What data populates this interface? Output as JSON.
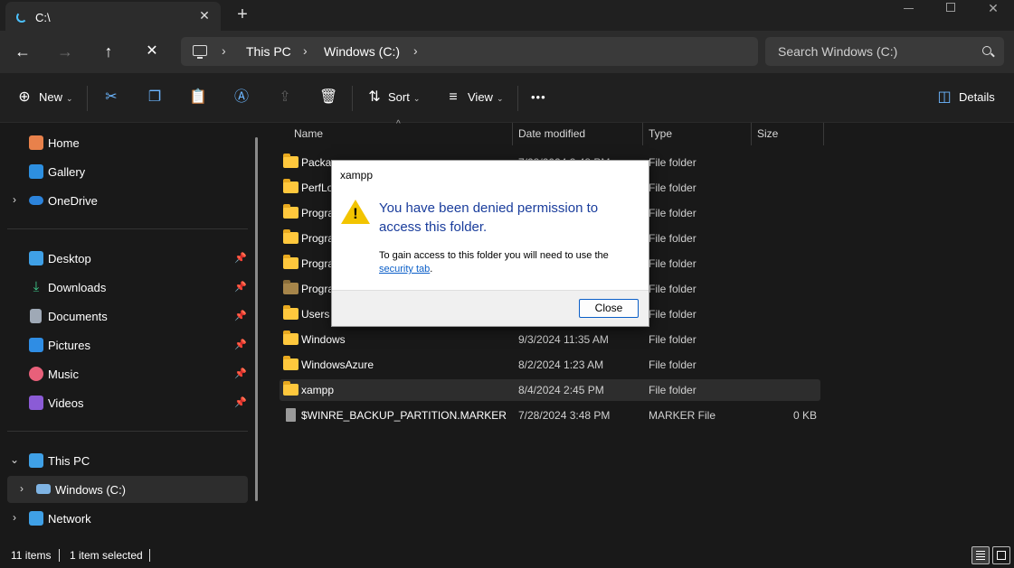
{
  "tab": {
    "title": "C:\\"
  },
  "window_controls": {
    "minimize": "minimize",
    "maximize": "maximize",
    "close": "close"
  },
  "address": {
    "crumbs": [
      "This PC",
      "Windows (C:)"
    ],
    "search_placeholder": "Search Windows (C:)"
  },
  "commands": {
    "new_label": "New",
    "sort_label": "Sort",
    "view_label": "View",
    "details_label": "Details",
    "more_label": "•••"
  },
  "sidebar": {
    "quick": [
      {
        "label": "Home",
        "icon": "home-icon"
      },
      {
        "label": "Gallery",
        "icon": "gallery-icon"
      },
      {
        "label": "OneDrive",
        "icon": "cloud-icon"
      }
    ],
    "pinned": [
      {
        "label": "Desktop",
        "icon": "desktop-icon"
      },
      {
        "label": "Downloads",
        "icon": "downloads-icon"
      },
      {
        "label": "Documents",
        "icon": "documents-icon"
      },
      {
        "label": "Pictures",
        "icon": "pictures-icon"
      },
      {
        "label": "Music",
        "icon": "music-icon"
      },
      {
        "label": "Videos",
        "icon": "videos-icon"
      }
    ],
    "devices": [
      {
        "label": "This PC",
        "icon": "pc-icon"
      },
      {
        "label": "Windows (C:)",
        "icon": "drive-icon"
      },
      {
        "label": "Network",
        "icon": "network-icon"
      }
    ]
  },
  "columns": {
    "name": "Name",
    "date": "Date modified",
    "type": "Type",
    "size": "Size"
  },
  "files": [
    {
      "name": "Packages",
      "date": "7/28/2024 3:48 PM",
      "type": "File folder",
      "size": ""
    },
    {
      "name": "PerfLogs",
      "date": "",
      "type": "File folder",
      "size": ""
    },
    {
      "name": "Program Files",
      "date": "",
      "type": "File folder",
      "size": ""
    },
    {
      "name": "Program Files (x86)",
      "date": "",
      "type": "File folder",
      "size": ""
    },
    {
      "name": "ProgramData",
      "date": "",
      "type": "File folder",
      "size": ""
    },
    {
      "name": "Programs",
      "date": "",
      "type": "File folder",
      "size": ""
    },
    {
      "name": "Users",
      "date": "",
      "type": "File folder",
      "size": ""
    },
    {
      "name": "Windows",
      "date": "9/3/2024 11:35 AM",
      "type": "File folder",
      "size": ""
    },
    {
      "name": "WindowsAzure",
      "date": "8/2/2024 1:23 AM",
      "type": "File folder",
      "size": ""
    },
    {
      "name": "xampp",
      "date": "8/4/2024 2:45 PM",
      "type": "File folder",
      "size": ""
    },
    {
      "name": "$WINRE_BACKUP_PARTITION.MARKER",
      "date": "7/28/2024 3:48 PM",
      "type": "MARKER File",
      "size": "0 KB"
    }
  ],
  "status": {
    "count": "11 items",
    "selected": "1 item selected"
  },
  "dialog": {
    "title": "xampp",
    "heading": "You have been denied permission to access this folder.",
    "body_prefix": "To gain access to this folder you will need to use the ",
    "link": "security tab",
    "body_suffix": ".",
    "close_label": "Close"
  },
  "colors": {
    "accent": "#4cc2ff",
    "folder": "#ffc83d",
    "dialog_heading": "#1a3d9c",
    "link": "#0b5fc8"
  }
}
